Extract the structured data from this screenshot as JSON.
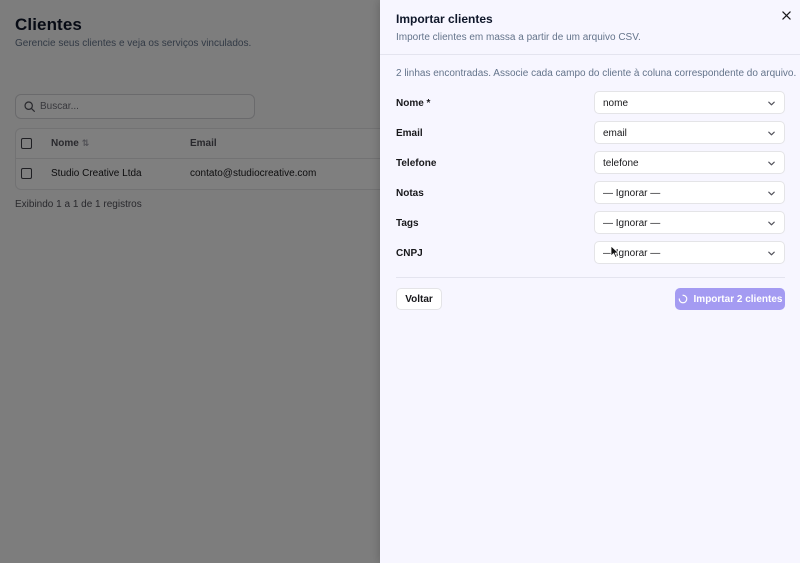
{
  "page": {
    "title": "Clientes",
    "subtitle": "Gerencie seus clientes e veja os serviços vinculados.",
    "search": {
      "placeholder": "Buscar...",
      "value": "",
      "icon": "search-icon"
    },
    "table": {
      "columns": [
        "Nome",
        "Email"
      ],
      "rows": [
        {
          "name": "Studio Creative Ltda",
          "email": "contato@studiocreative.com"
        }
      ]
    },
    "records_text": "Exibindo 1 a 1 de 1 registros"
  },
  "sheet": {
    "title": "Importar clientes",
    "description": "Importe clientes em massa a partir de um arquivo CSV.",
    "info": "2 linhas encontradas. Associe cada campo do cliente à coluna correspondente do arquivo.",
    "fields": [
      {
        "label": "Nome *",
        "value": "nome"
      },
      {
        "label": "Email",
        "value": "email"
      },
      {
        "label": "Telefone",
        "value": "telefone"
      },
      {
        "label": "Notas",
        "value": "— Ignorar —"
      },
      {
        "label": "Tags",
        "value": "— Ignorar —"
      },
      {
        "label": "CNPJ",
        "value": "— Ignorar —"
      }
    ],
    "back_label": "Voltar",
    "import_label": "Importar 2 clientes"
  },
  "colors": {
    "accent": "#a49bf2",
    "sheet_background": "#f7f6ff",
    "overlay": "rgba(0,0,0,0.5)"
  }
}
